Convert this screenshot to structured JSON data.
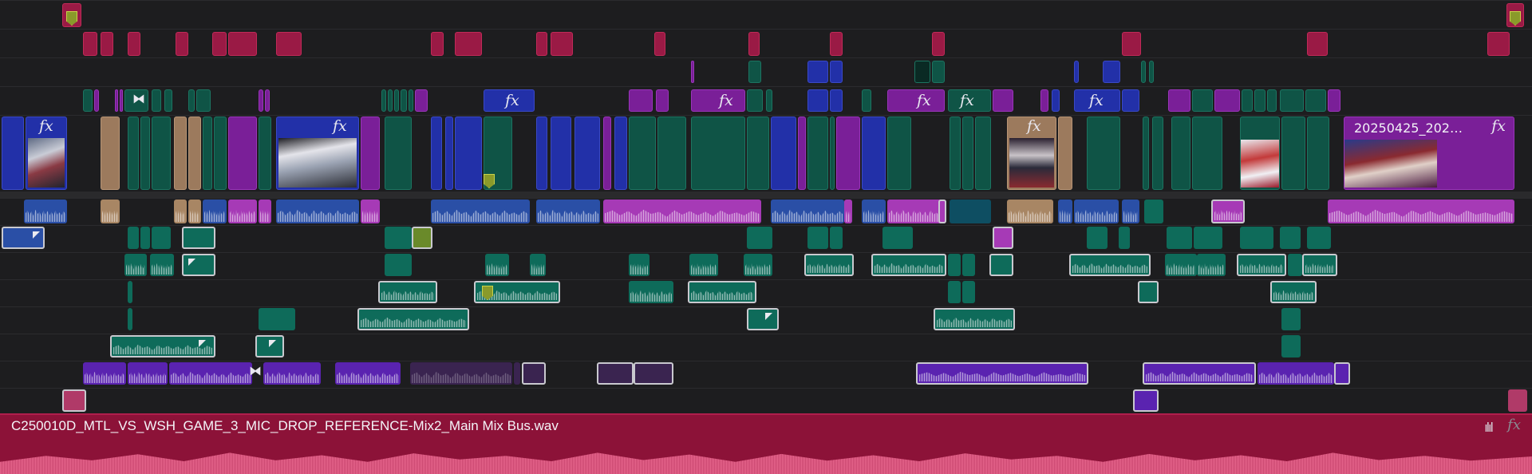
{
  "timeline": {
    "video_clip_label": "20250425_202…",
    "fx_label": "fx",
    "main_audio_clip_name": "C250010D_MTL_VS_WSH_GAME_3_MIC_DROP_REFERENCE-Mix2_Main Mix Bus.wav",
    "waveform_icon_glyph": "ılıl",
    "colors": {
      "background": "#1d1d1f",
      "video_blue": "#2230a8",
      "video_teal": "#0f5446",
      "video_purple": "#7a1f98",
      "video_tan": "#9c7a5d",
      "title_red": "#9a1a45",
      "audio_pink": "#a63ab6",
      "audio_violet": "#5a23b0",
      "main_audio": "#8c1238",
      "marker": "#8a9a2a"
    },
    "icons": [
      "fx-icon",
      "marker-icon",
      "waveform-icon",
      "transition-icon",
      "keyframe-icon"
    ]
  }
}
